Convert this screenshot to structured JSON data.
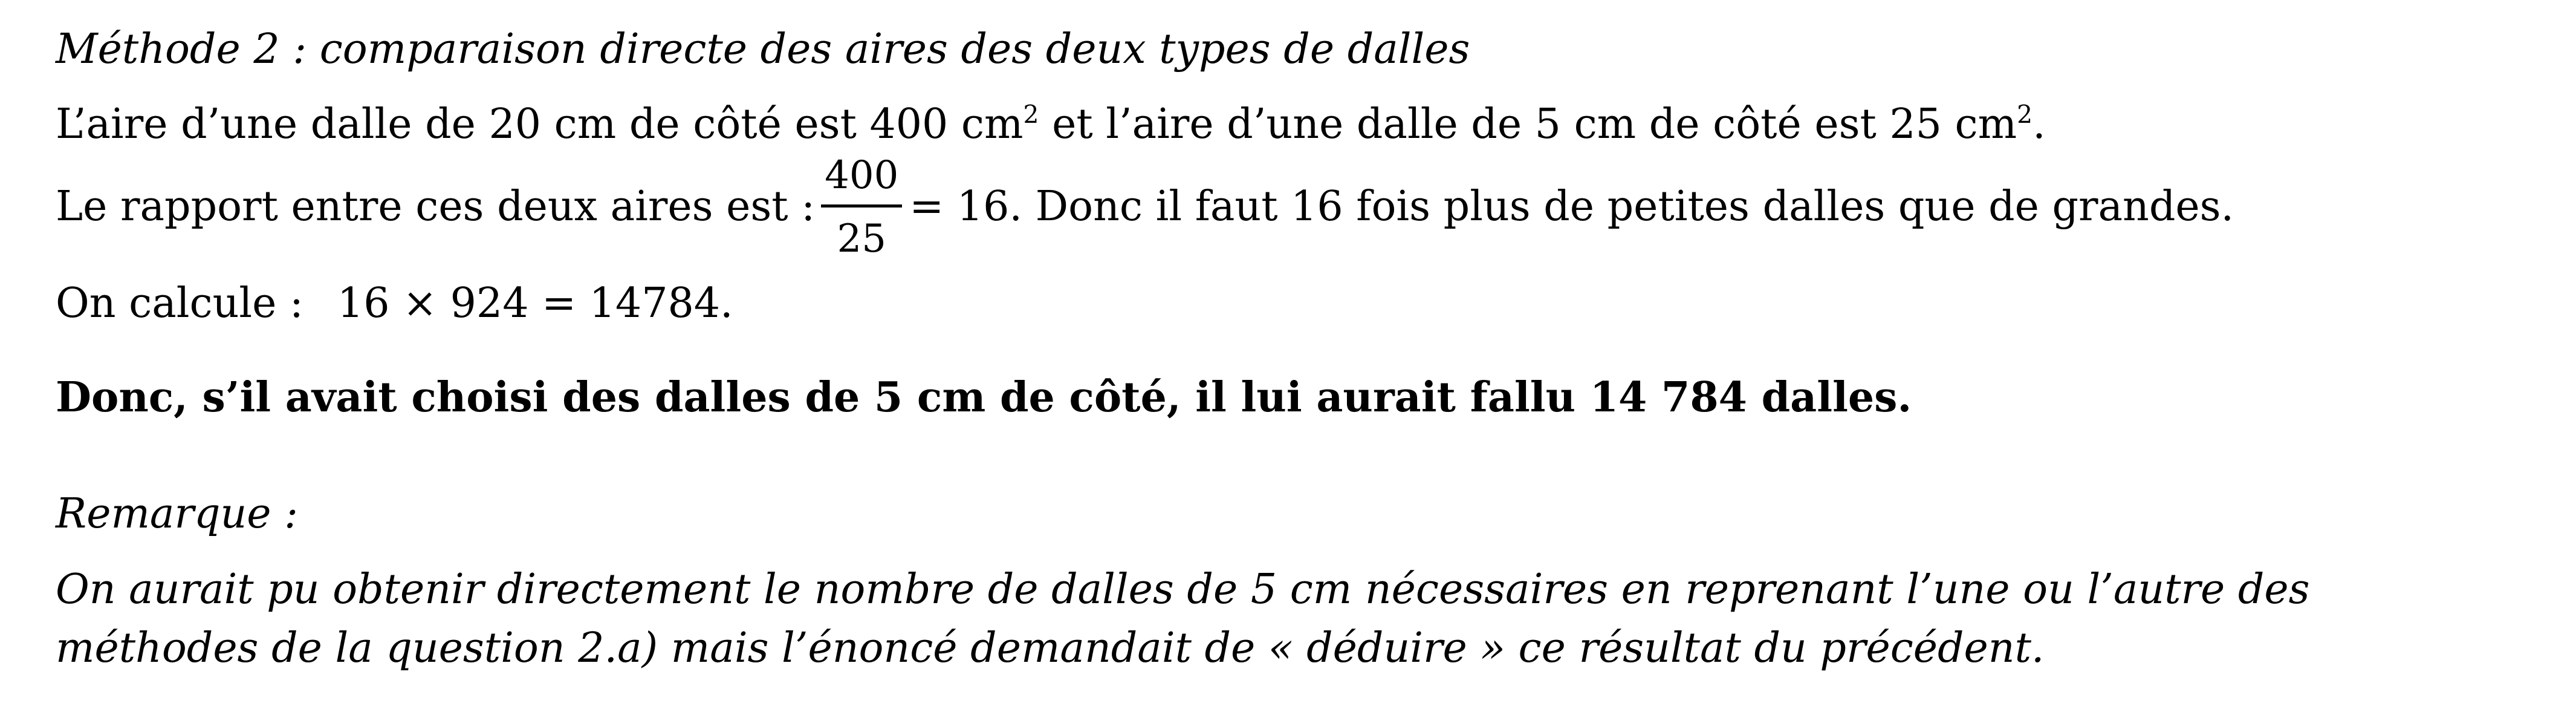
{
  "title": "Méthode 2 : comparaison directe des aires des deux types de dalles",
  "line_areas": {
    "part1": "L’aire d’une dalle de 20 cm de côté est 400 cm",
    "sup1": "2",
    "part2": " et l’aire d’une dalle de 5 cm de côté est 25 cm",
    "sup2": "2",
    "part3": "."
  },
  "line_ratio": {
    "before": "Le rapport entre ces deux aires est :",
    "numerator": "400",
    "denominator": "25",
    "after": "= 16. Donc il faut 16 fois plus de petites dalles que de grandes."
  },
  "line_calc": {
    "label": "On calcule :",
    "expression": "16 × 924 = 14784."
  },
  "conclusion": "Donc, s’il avait choisi des dalles de 5 cm de côté, il lui aurait fallu 14 784 dalles.",
  "remark": {
    "heading": "Remarque :",
    "line1": "On aurait pu obtenir directement le nombre de dalles de 5 cm nécessaires en reprenant l’une ou l’autre des",
    "line2": "méthodes de la question 2.a) mais l’énoncé demandait de « déduire » ce résultat du précédent."
  }
}
